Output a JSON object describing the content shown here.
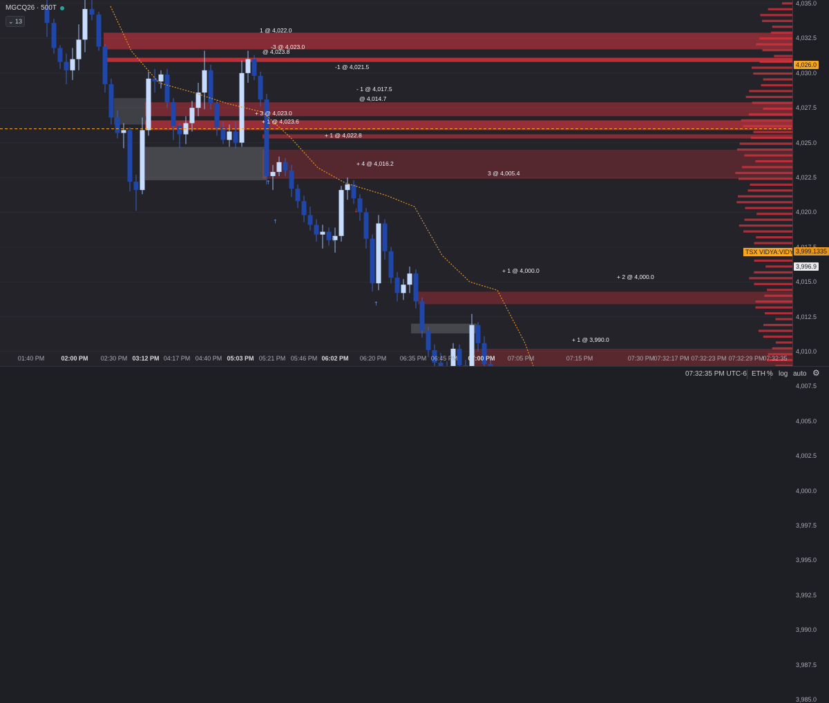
{
  "header": {
    "symbol": "MGCQ26 · 500T",
    "interval_value": "13"
  },
  "colors": {
    "bull": "#c7dcff",
    "bear": "#1f46a8",
    "supply": "#d8343f",
    "demand": "#26a69a",
    "vidya": "#e8961c",
    "accent": "#f5a623"
  },
  "price_axis": {
    "ticks": [
      "4,035.0",
      "4,032.5",
      "4,030.0",
      "4,027.5",
      "4,025.0",
      "4,022.5",
      "4,020.0",
      "4,017.5",
      "4,015.0",
      "4,012.5",
      "4,010.0",
      "4,007.5",
      "4,005.0",
      "4,002.5",
      "4,000.0",
      "3,997.5",
      "3,995.0",
      "3,992.5",
      "3,990.0",
      "3,987.5",
      "3,985.0"
    ],
    "current_price": "4,026.0",
    "vidya_price": "3,999.1335",
    "last_price": "3,996.9",
    "vidya_label": "TSX VIDYA:VIDYA"
  },
  "time_axis": {
    "ticks": [
      {
        "label": "01:40 PM",
        "bold": false
      },
      {
        "label": "02:00 PM",
        "bold": true
      },
      {
        "label": "02:30 PM",
        "bold": false
      },
      {
        "label": "03:12 PM",
        "bold": true
      },
      {
        "label": "04:17 PM",
        "bold": false
      },
      {
        "label": "04:40 PM",
        "bold": false
      },
      {
        "label": "05:03 PM",
        "bold": true
      },
      {
        "label": "05:21 PM",
        "bold": false
      },
      {
        "label": "05:46 PM",
        "bold": false
      },
      {
        "label": "06:02 PM",
        "bold": true
      },
      {
        "label": "06:20 PM",
        "bold": false
      },
      {
        "label": "06:35 PM",
        "bold": false
      },
      {
        "label": "06:45 PM",
        "bold": false
      },
      {
        "label": "07:00 PM",
        "bold": true
      },
      {
        "label": "07:05 PM",
        "bold": false
      },
      {
        "label": "07:15 PM",
        "bold": false
      },
      {
        "label": "07:30 PM",
        "bold": false
      },
      {
        "label": "07:32:17 PM",
        "bold": false
      },
      {
        "label": "07:32:23 PM",
        "bold": false
      },
      {
        "label": "07:32:29 PM",
        "bold": false
      },
      {
        "label": "07:32:35",
        "bold": false
      }
    ]
  },
  "trades": [
    {
      "text": "1 @ 4,022.0"
    },
    {
      "text": "-3 @ 4,023.0"
    },
    {
      "text": "@ 4,023.8"
    },
    {
      "text": "-1 @ 4,021.5"
    },
    {
      "text": "- 1 @ 4,017.5"
    },
    {
      "text": "@ 4,014.7"
    },
    {
      "text": "+ 3 @ 4,023.0"
    },
    {
      "text": "+ 1 @ 4,023.6"
    },
    {
      "text": "+ 1 @ 4,022.8"
    },
    {
      "text": "+ 4 @ 4,016.2"
    },
    {
      "text": "3 @ 4,005.4"
    },
    {
      "text": "+ 1 @ 4,000.0"
    },
    {
      "text": "+ 2 @ 4,000.0"
    },
    {
      "text": "+ 1 @ 3,990.0"
    }
  ],
  "bottom_bar": {
    "clock": "07:32:35 PM UTC-6",
    "session": "ETH",
    "percent": "%",
    "log": "log",
    "auto": "auto"
  }
}
